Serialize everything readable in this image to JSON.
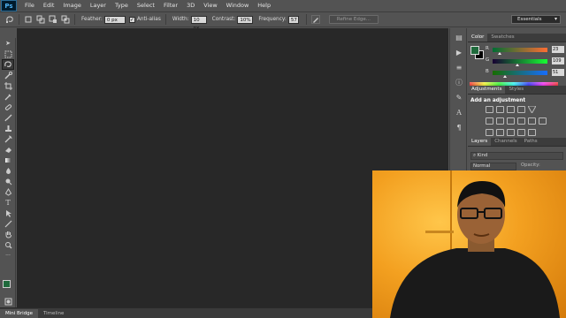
{
  "app": {
    "logo": "Ps"
  },
  "menu": [
    "File",
    "Edit",
    "Image",
    "Layer",
    "Type",
    "Select",
    "Filter",
    "3D",
    "View",
    "Window",
    "Help"
  ],
  "options": {
    "feather_label": "Feather:",
    "feather_value": "0 px",
    "antialias_label": "Anti-alias",
    "width_label": "Width:",
    "width_value": "10 px",
    "contrast_label": "Contrast:",
    "contrast_value": "10%",
    "frequency_label": "Frequency:",
    "frequency_value": "57",
    "refine_edge": "Refine Edge...",
    "workspace": "Essentials"
  },
  "color_panel": {
    "tabs": [
      "Color",
      "Swatches"
    ],
    "foreground": "#1f6a3c",
    "background": "#000000",
    "channels": [
      {
        "label": "R",
        "value": "23"
      },
      {
        "label": "G",
        "value": "109"
      },
      {
        "label": "B",
        "value": "51"
      }
    ]
  },
  "adjustments_panel": {
    "tabs": [
      "Adjustments",
      "Styles"
    ],
    "title": "Add an adjustment"
  },
  "layers_panel": {
    "tabs": [
      "Layers",
      "Channels",
      "Paths"
    ],
    "filter_kind": "Kind",
    "blend_mode": "Normal",
    "opacity_label": "Opacity:"
  },
  "bottom_tabs": [
    "Mini Bridge",
    "Timeline"
  ]
}
